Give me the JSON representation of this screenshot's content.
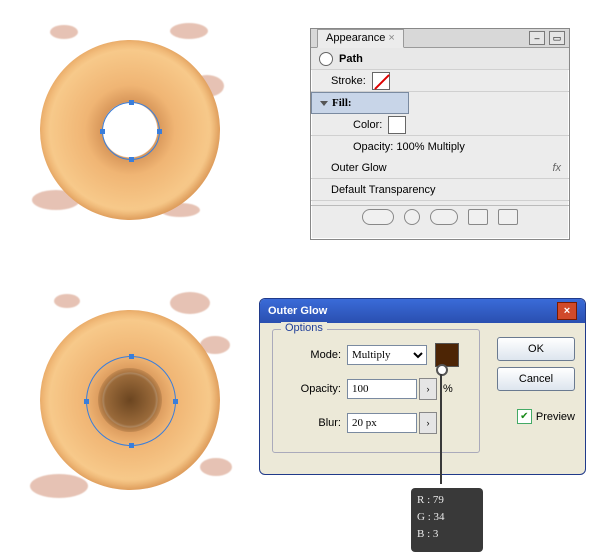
{
  "panels": {
    "appearance": {
      "title": "Appearance",
      "object": "Path",
      "rows": {
        "stroke": "Stroke:",
        "fill": "Fill:",
        "color": "Color:",
        "opacity": "Opacity: 100% Multiply",
        "effect": "Outer Glow",
        "default": "Default Transparency"
      }
    }
  },
  "dialog": {
    "title": "Outer Glow",
    "legend": "Options",
    "modeLabel": "Mode:",
    "modeValue": "Multiply",
    "opacityLabel": "Opacity:",
    "opacityValue": "100",
    "opacitySuffix": "%",
    "blurLabel": "Blur:",
    "blurValue": "20 px",
    "ok": "OK",
    "cancel": "Cancel",
    "preview": "Preview"
  },
  "callout": {
    "r": "R : 79",
    "g": "G : 34",
    "b": "B :   3"
  }
}
